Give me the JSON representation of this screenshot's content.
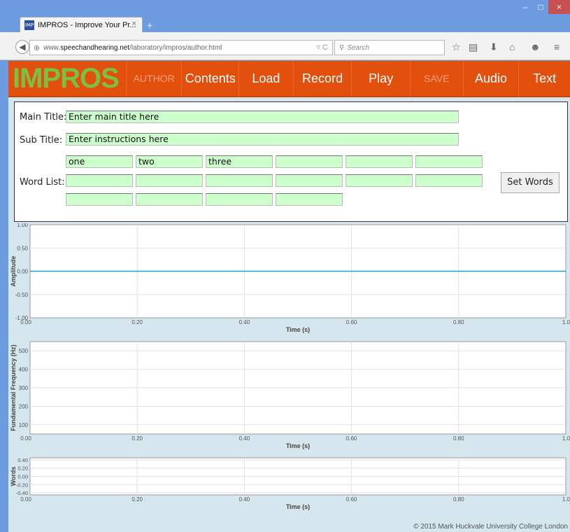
{
  "browser": {
    "tab_title": "IMPROS - Improve Your Pr...",
    "tab_close": "×",
    "new_tab": "+",
    "win_min": "–",
    "win_max": "□",
    "win_close": "×",
    "url_prefix": "www.",
    "url_host": "speechandhearing.net",
    "url_path": "/laboratory/impros/author.html",
    "search_placeholder": "Search",
    "favicon_text": "IMP"
  },
  "menu": {
    "logo": "IMPROS",
    "items": [
      {
        "label": "AUTHOR",
        "dim": true
      },
      {
        "label": "Contents",
        "dim": false
      },
      {
        "label": "Load",
        "dim": false
      },
      {
        "label": "Record",
        "dim": false
      },
      {
        "label": "Play",
        "dim": false
      },
      {
        "label": "SAVE",
        "dim": true
      },
      {
        "label": "Audio",
        "dim": false
      },
      {
        "label": "Text",
        "dim": false
      }
    ]
  },
  "author": {
    "main_title_label": "Main Title:",
    "main_title_value": "Enter main title here",
    "sub_title_label": "Sub Title:",
    "sub_title_value": "Enter instructions here",
    "word_list_label": "Word List:",
    "words": [
      "one",
      "two",
      "three",
      "",
      "",
      "",
      "",
      "",
      "",
      "",
      "",
      "",
      "",
      "",
      "",
      ""
    ],
    "set_words_button": "Set Words"
  },
  "chart_data": [
    {
      "type": "line",
      "ylabel": "Amplitude",
      "xlabel": "Time (s)",
      "xlim": [
        0,
        1
      ],
      "ylim": [
        -1,
        1
      ],
      "x_ticks": [
        "0.00",
        "0.20",
        "0.40",
        "0.60",
        "0.80",
        "1.0"
      ],
      "y_ticks": [
        "-1.00",
        "-0.50",
        "0.00",
        "0.50",
        "1.00"
      ],
      "y_tick_values": [
        -1,
        -0.5,
        0,
        0.5,
        1
      ],
      "series": [
        {
          "x": [
            0,
            1
          ],
          "y": [
            0,
            0
          ],
          "color": "#1e9fd0"
        }
      ]
    },
    {
      "type": "line",
      "ylabel": "Fundamental Frequency (Hz)",
      "xlabel": "Time (s)",
      "xlim": [
        0,
        1
      ],
      "ylim": [
        50,
        550
      ],
      "x_ticks": [
        "0.00",
        "0.20",
        "0.40",
        "0.60",
        "0.80",
        "1.0"
      ],
      "y_ticks": [
        "100",
        "200",
        "300",
        "400",
        "500"
      ],
      "y_tick_values": [
        100,
        200,
        300,
        400,
        500
      ],
      "series": []
    },
    {
      "type": "line",
      "ylabel": "Words",
      "xlabel": "Time (s)",
      "xlim": [
        0,
        1
      ],
      "ylim": [
        -0.45,
        0.45
      ],
      "x_ticks": [
        "0.00",
        "0.20",
        "0.40",
        "0.60",
        "0.80",
        "1.0"
      ],
      "y_ticks": [
        "-0.40",
        "-0.20",
        "0.00",
        "0.20",
        "0.40"
      ],
      "y_tick_values": [
        -0.4,
        -0.2,
        0,
        0.2,
        0.4
      ],
      "series": []
    }
  ],
  "footer": {
    "copyright": "© 2015 Mark Huckvale University College London"
  }
}
